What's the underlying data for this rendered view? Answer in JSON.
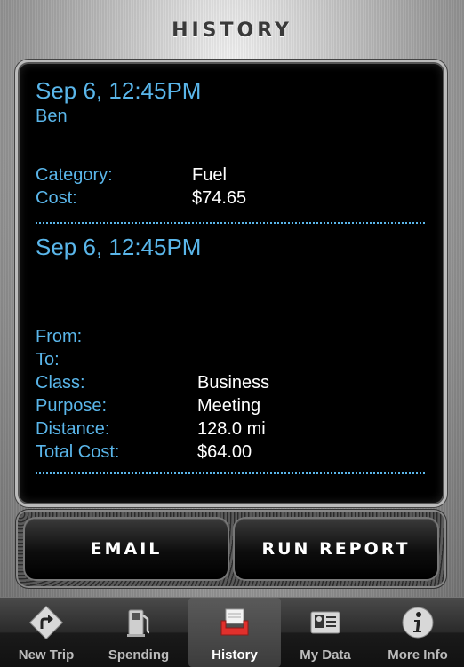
{
  "header": {
    "title": "HISTORY"
  },
  "entries": [
    {
      "datetime": "Sep 6, 12:45PM",
      "name": "Ben",
      "fields": [
        {
          "label": "Category:",
          "value": "Fuel"
        },
        {
          "label": "Cost:",
          "value": "$74.65"
        }
      ]
    },
    {
      "datetime": "Sep 6, 12:45PM",
      "fields": [
        {
          "label": "From:",
          "value": ""
        },
        {
          "label": "To:",
          "value": ""
        },
        {
          "label": "Class:",
          "value": "Business"
        },
        {
          "label": "Purpose:",
          "value": "Meeting"
        },
        {
          "label": "Distance:",
          "value": "128.0 mi"
        },
        {
          "label": "Total Cost:",
          "value": "$64.00"
        }
      ]
    }
  ],
  "buttons": {
    "email": "EMAIL",
    "run_report": "RUN REPORT"
  },
  "tabs": [
    {
      "label": "New Trip",
      "icon": "turn-sign-icon"
    },
    {
      "label": "Spending",
      "icon": "gas-pump-icon"
    },
    {
      "label": "History",
      "icon": "inbox-tray-icon",
      "active": true
    },
    {
      "label": "My Data",
      "icon": "id-card-icon"
    },
    {
      "label": "More Info",
      "icon": "info-icon"
    }
  ],
  "colors": {
    "accent": "#5ab6ea",
    "value_text": "#ffffff",
    "active_tab_icon": "#e0302c"
  }
}
